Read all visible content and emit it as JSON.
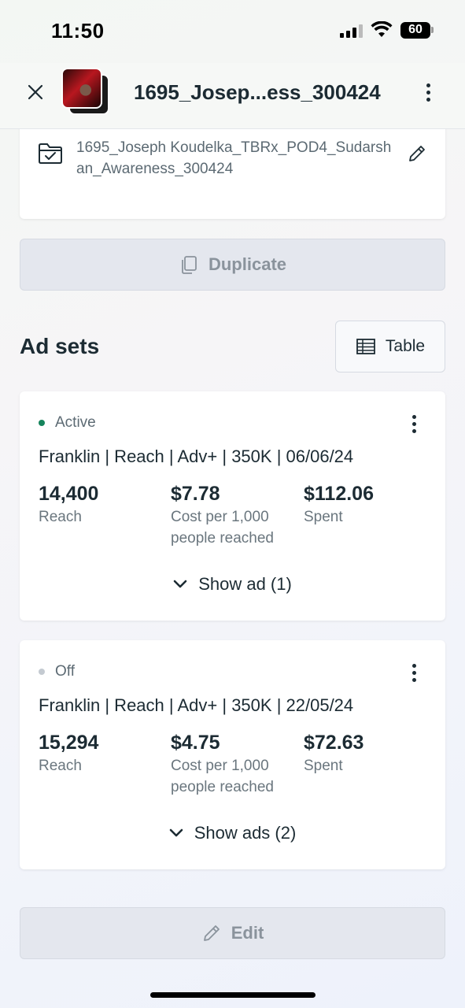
{
  "status_bar": {
    "time": "11:50",
    "battery": "60"
  },
  "header": {
    "title": "1695_Josep...ess_300424"
  },
  "campaign": {
    "name": "1695_Joseph Koudelka_TBRx_POD4_Sudarshan_Awareness_300424"
  },
  "actions": {
    "duplicate_label": "Duplicate",
    "edit_label": "Edit"
  },
  "ad_sets": {
    "title": "Ad sets",
    "table_label": "Table",
    "items": [
      {
        "status": "Active",
        "status_color": "#16845c",
        "name": "Franklin | Reach | Adv+ | 350K | 06/06/24",
        "reach": "14,400",
        "reach_label": "Reach",
        "cost": "$7.78",
        "cost_label": "Cost per 1,000 people reached",
        "spent": "$112.06",
        "spent_label": "Spent",
        "show_ads": "Show ad (1)"
      },
      {
        "status": "Off",
        "status_color": "#c4cad1",
        "name": "Franklin | Reach | Adv+ | 350K | 22/05/24",
        "reach": "15,294",
        "reach_label": "Reach",
        "cost": "$4.75",
        "cost_label": "Cost per 1,000 people reached",
        "spent": "$72.63",
        "spent_label": "Spent",
        "show_ads": "Show ads (2)"
      }
    ]
  },
  "icons": [
    "close-icon",
    "more-icon",
    "folder-check-icon",
    "pencil-icon",
    "copy-icon",
    "table-icon",
    "chevron-down-icon"
  ]
}
